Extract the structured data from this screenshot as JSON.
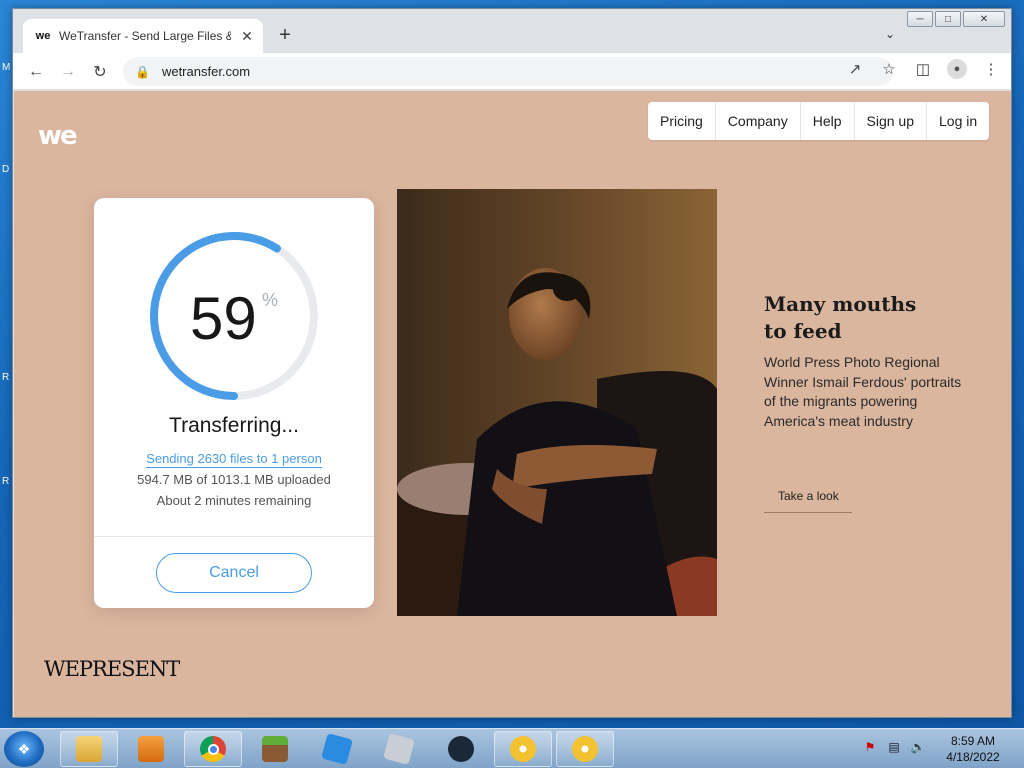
{
  "browser": {
    "tab_title": "WeTransfer - Send Large Files & Share Photos Online",
    "tab_favicon": "we",
    "url": "wetransfer.com",
    "close_tab": "✕",
    "new_tab": "+"
  },
  "site": {
    "logo": "we",
    "nav": [
      {
        "label": "Pricing"
      },
      {
        "label": "Company"
      },
      {
        "label": "Help"
      },
      {
        "label": "Sign up"
      },
      {
        "label": "Log in"
      }
    ]
  },
  "transfer": {
    "progress": 59,
    "percent_symbol": "%",
    "status": "Transferring...",
    "sending": "Sending 2630 files to 1 person",
    "uploaded": "594.7 MB of 1013.1 MB uploaded",
    "remaining": "About 2 minutes remaining",
    "cancel_label": "Cancel"
  },
  "story": {
    "title_line1": "Many mouths",
    "title_line2": "to feed",
    "text": "World Press Photo Regional Winner Ismail Ferdous' portraits of the migrants powering America's meat industry",
    "link": "Take a look",
    "brand": "WEPRESENT"
  },
  "taskbar": {
    "time": "8:59 AM",
    "date": "4/18/2022"
  },
  "colors": {
    "page_bg": "#dbb69f",
    "accent_blue": "#4a9ce6",
    "ring_track": "#e8eaed"
  }
}
